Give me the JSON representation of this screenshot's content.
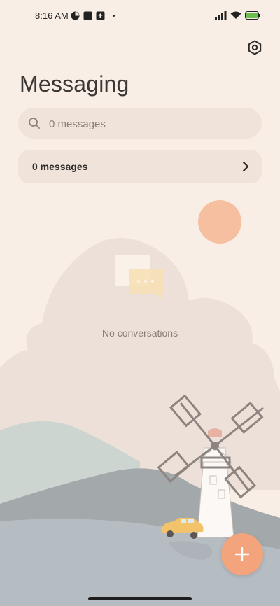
{
  "status_bar": {
    "time": "8:16 AM",
    "battery": "100"
  },
  "header": {
    "title": "Messaging"
  },
  "search": {
    "placeholder": "0 messages"
  },
  "summary": {
    "label": "0 messages"
  },
  "empty_state": {
    "text": "No conversations"
  },
  "icons": {
    "settings": "gear-icon",
    "search": "search-icon",
    "chevron": "chevron-right-icon",
    "fab": "plus-icon"
  },
  "colors": {
    "background": "#f9eee6",
    "card": "#efe3da",
    "accent": "#f4a47c"
  }
}
